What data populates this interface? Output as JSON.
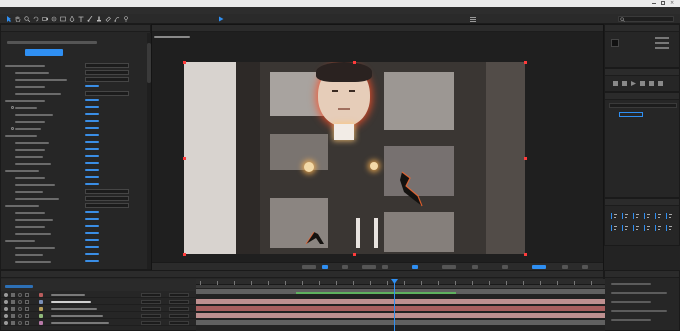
{
  "app": {
    "window_title": "",
    "menu": [
      "",
      "",
      "",
      "",
      "",
      "",
      "",
      "",
      "",
      ""
    ]
  },
  "toolbar": {
    "workspace_tabs": [
      "",
      "",
      "",
      ""
    ],
    "active_workspace_index": 1,
    "search_placeholder": ""
  },
  "effects_panel": {
    "tabs": [
      "",
      ""
    ],
    "header_line": "",
    "button_label": "",
    "rows": [
      "",
      "",
      "",
      "",
      "",
      "",
      "",
      "",
      "",
      "",
      "",
      "",
      "",
      "",
      "",
      "",
      "",
      "",
      "",
      "",
      "",
      "",
      "",
      "",
      "",
      "",
      "",
      "",
      "",
      ""
    ]
  },
  "composition_panel": {
    "tabs": [
      "",
      "",
      ""
    ],
    "comp_label": "",
    "zoom": "",
    "time": "",
    "resolution": ""
  },
  "right_panels": {
    "info_title": "",
    "preview_title": "",
    "effects_presets_title": "",
    "align_title": "",
    "para_title": ""
  },
  "timeline": {
    "tab": "",
    "current_time": "",
    "layers": [
      "",
      "",
      "",
      "",
      ""
    ]
  },
  "colors": {
    "accent": "#2f8ff2",
    "mask_outline": "#ff3b3b",
    "bar_green": "#5fbf5f",
    "bar_red": "#c06a6a",
    "bar_pink": "#d9a3a3",
    "bar_grey": "#6b6b6b"
  },
  "icons": [
    "select-tool-icon",
    "hand-tool-icon",
    "zoom-tool-icon",
    "rotate-tool-icon",
    "camera-tool-icon",
    "pan-behind-icon",
    "rectangle-tool-icon",
    "pen-tool-icon",
    "type-tool-icon",
    "brush-tool-icon",
    "clone-stamp-icon",
    "eraser-icon",
    "roto-brush-icon",
    "puppet-pin-icon",
    "search-icon",
    "play-icon",
    "stopwatch-icon",
    "eye-icon",
    "audio-icon",
    "solo-icon",
    "lock-icon"
  ]
}
